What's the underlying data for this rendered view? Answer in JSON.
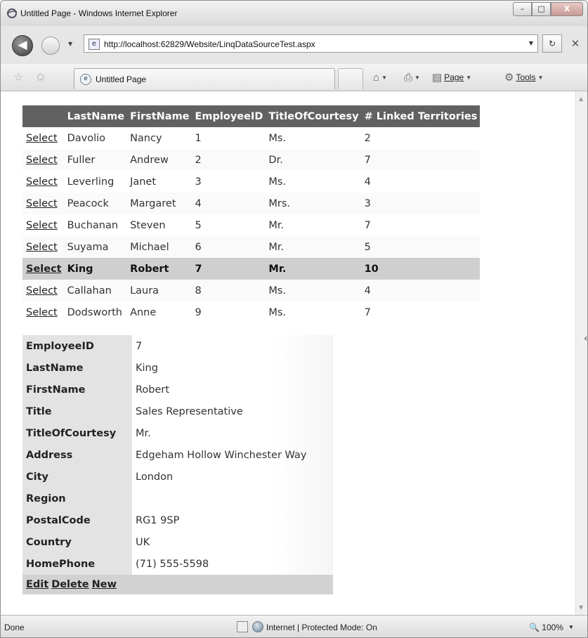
{
  "window": {
    "title": "Untitled Page - Windows Internet Explorer",
    "controls": {
      "minimize": "–",
      "maximize": "□",
      "close": "X"
    }
  },
  "address_bar": {
    "url": "http://localhost:62829/Website/LinqDataSourceTest.aspx"
  },
  "toolbar": {
    "tab_title": "Untitled Page",
    "page_menu": "Page",
    "tools_menu": "Tools"
  },
  "grid": {
    "select_label": "Select",
    "columns": [
      "LastName",
      "FirstName",
      "EmployeeID",
      "TitleOfCourtesy",
      "# Linked Territories"
    ],
    "rows": [
      [
        "Davolio",
        "Nancy",
        "1",
        "Ms.",
        "2"
      ],
      [
        "Fuller",
        "Andrew",
        "2",
        "Dr.",
        "7"
      ],
      [
        "Leverling",
        "Janet",
        "3",
        "Ms.",
        "4"
      ],
      [
        "Peacock",
        "Margaret",
        "4",
        "Mrs.",
        "3"
      ],
      [
        "Buchanan",
        "Steven",
        "5",
        "Mr.",
        "7"
      ],
      [
        "Suyama",
        "Michael",
        "6",
        "Mr.",
        "5"
      ],
      [
        "King",
        "Robert",
        "7",
        "Mr.",
        "10"
      ],
      [
        "Callahan",
        "Laura",
        "8",
        "Ms.",
        "4"
      ],
      [
        "Dodsworth",
        "Anne",
        "9",
        "Ms.",
        "7"
      ]
    ],
    "selected_row_index": 6
  },
  "details": {
    "fields": [
      {
        "label": "EmployeeID",
        "value": "7"
      },
      {
        "label": "LastName",
        "value": "King"
      },
      {
        "label": "FirstName",
        "value": "Robert"
      },
      {
        "label": "Title",
        "value": "Sales Representative"
      },
      {
        "label": "TitleOfCourtesy",
        "value": "Mr."
      },
      {
        "label": "Address",
        "value": "Edgeham Hollow Winchester Way"
      },
      {
        "label": "City",
        "value": "London"
      },
      {
        "label": "Region",
        "value": ""
      },
      {
        "label": "PostalCode",
        "value": "RG1 9SP"
      },
      {
        "label": "Country",
        "value": "UK"
      },
      {
        "label": "HomePhone",
        "value": "(71) 555-5598"
      }
    ],
    "commands": {
      "edit": "Edit",
      "delete": "Delete",
      "new": "New"
    }
  },
  "status_bar": {
    "status": "Done",
    "zone": "Internet | Protected Mode: On",
    "zoom": "100%"
  }
}
